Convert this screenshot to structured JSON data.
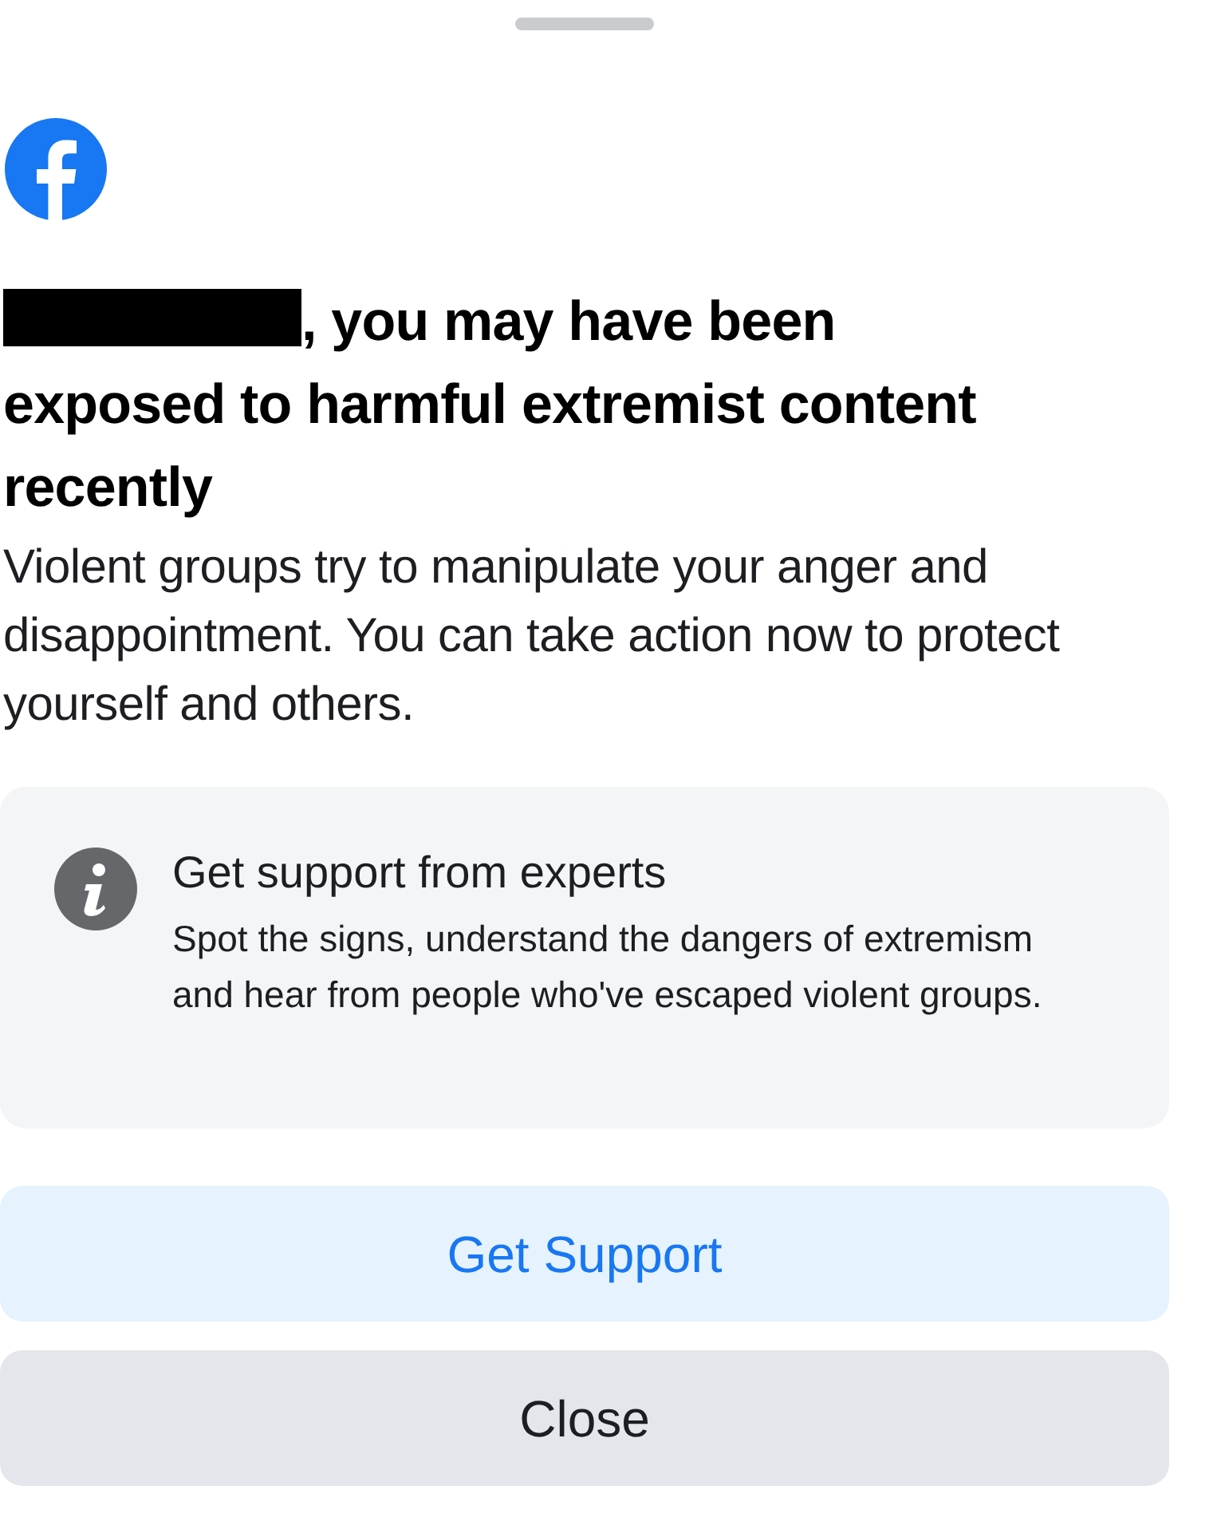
{
  "heading": {
    "redacted_name": true,
    "text": ", you may have been exposed to harmful extremist content recently"
  },
  "message": "Violent groups try to manipulate your anger and disappointment. You can take action now to protect yourself and others.",
  "info_card": {
    "title": "Get support from experts",
    "description": "Spot the signs, understand the dangers of extremism and hear from people who've escaped violent groups."
  },
  "buttons": [
    {
      "label": "Get Support",
      "kind": "primary"
    },
    {
      "label": "Close",
      "kind": "secondary"
    }
  ]
}
